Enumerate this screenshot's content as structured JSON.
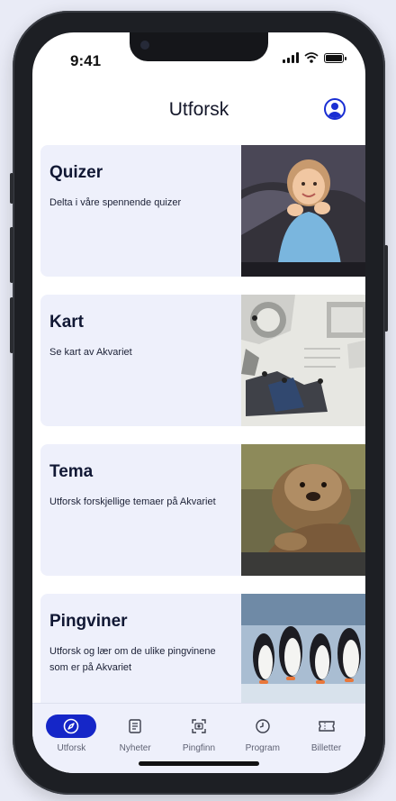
{
  "status_bar": {
    "time": "9:41"
  },
  "header": {
    "title": "Utforsk"
  },
  "cards": [
    {
      "title": "Quizer",
      "description": "Delta i våre spennende quizer"
    },
    {
      "title": "Kart",
      "description": "Se kart av Akvariet"
    },
    {
      "title": "Tema",
      "description": "Utforsk forskjellige temaer på Akvariet"
    },
    {
      "title": "Pingviner",
      "description": "Utforsk og lær om de ulike pingvinene som er på Akvariet"
    }
  ],
  "tabbar": {
    "items": [
      {
        "label": "Utforsk",
        "icon": "compass-icon",
        "active": true
      },
      {
        "label": "Nyheter",
        "icon": "newspaper-icon",
        "active": false
      },
      {
        "label": "Pingfinn",
        "icon": "camera-scan-icon",
        "active": false
      },
      {
        "label": "Program",
        "icon": "clock-icon",
        "active": false
      },
      {
        "label": "Billetter",
        "icon": "ticket-icon",
        "active": false
      }
    ]
  },
  "colors": {
    "accent": "#1526c8",
    "card_bg": "#eef0fb",
    "title": "#111834"
  }
}
